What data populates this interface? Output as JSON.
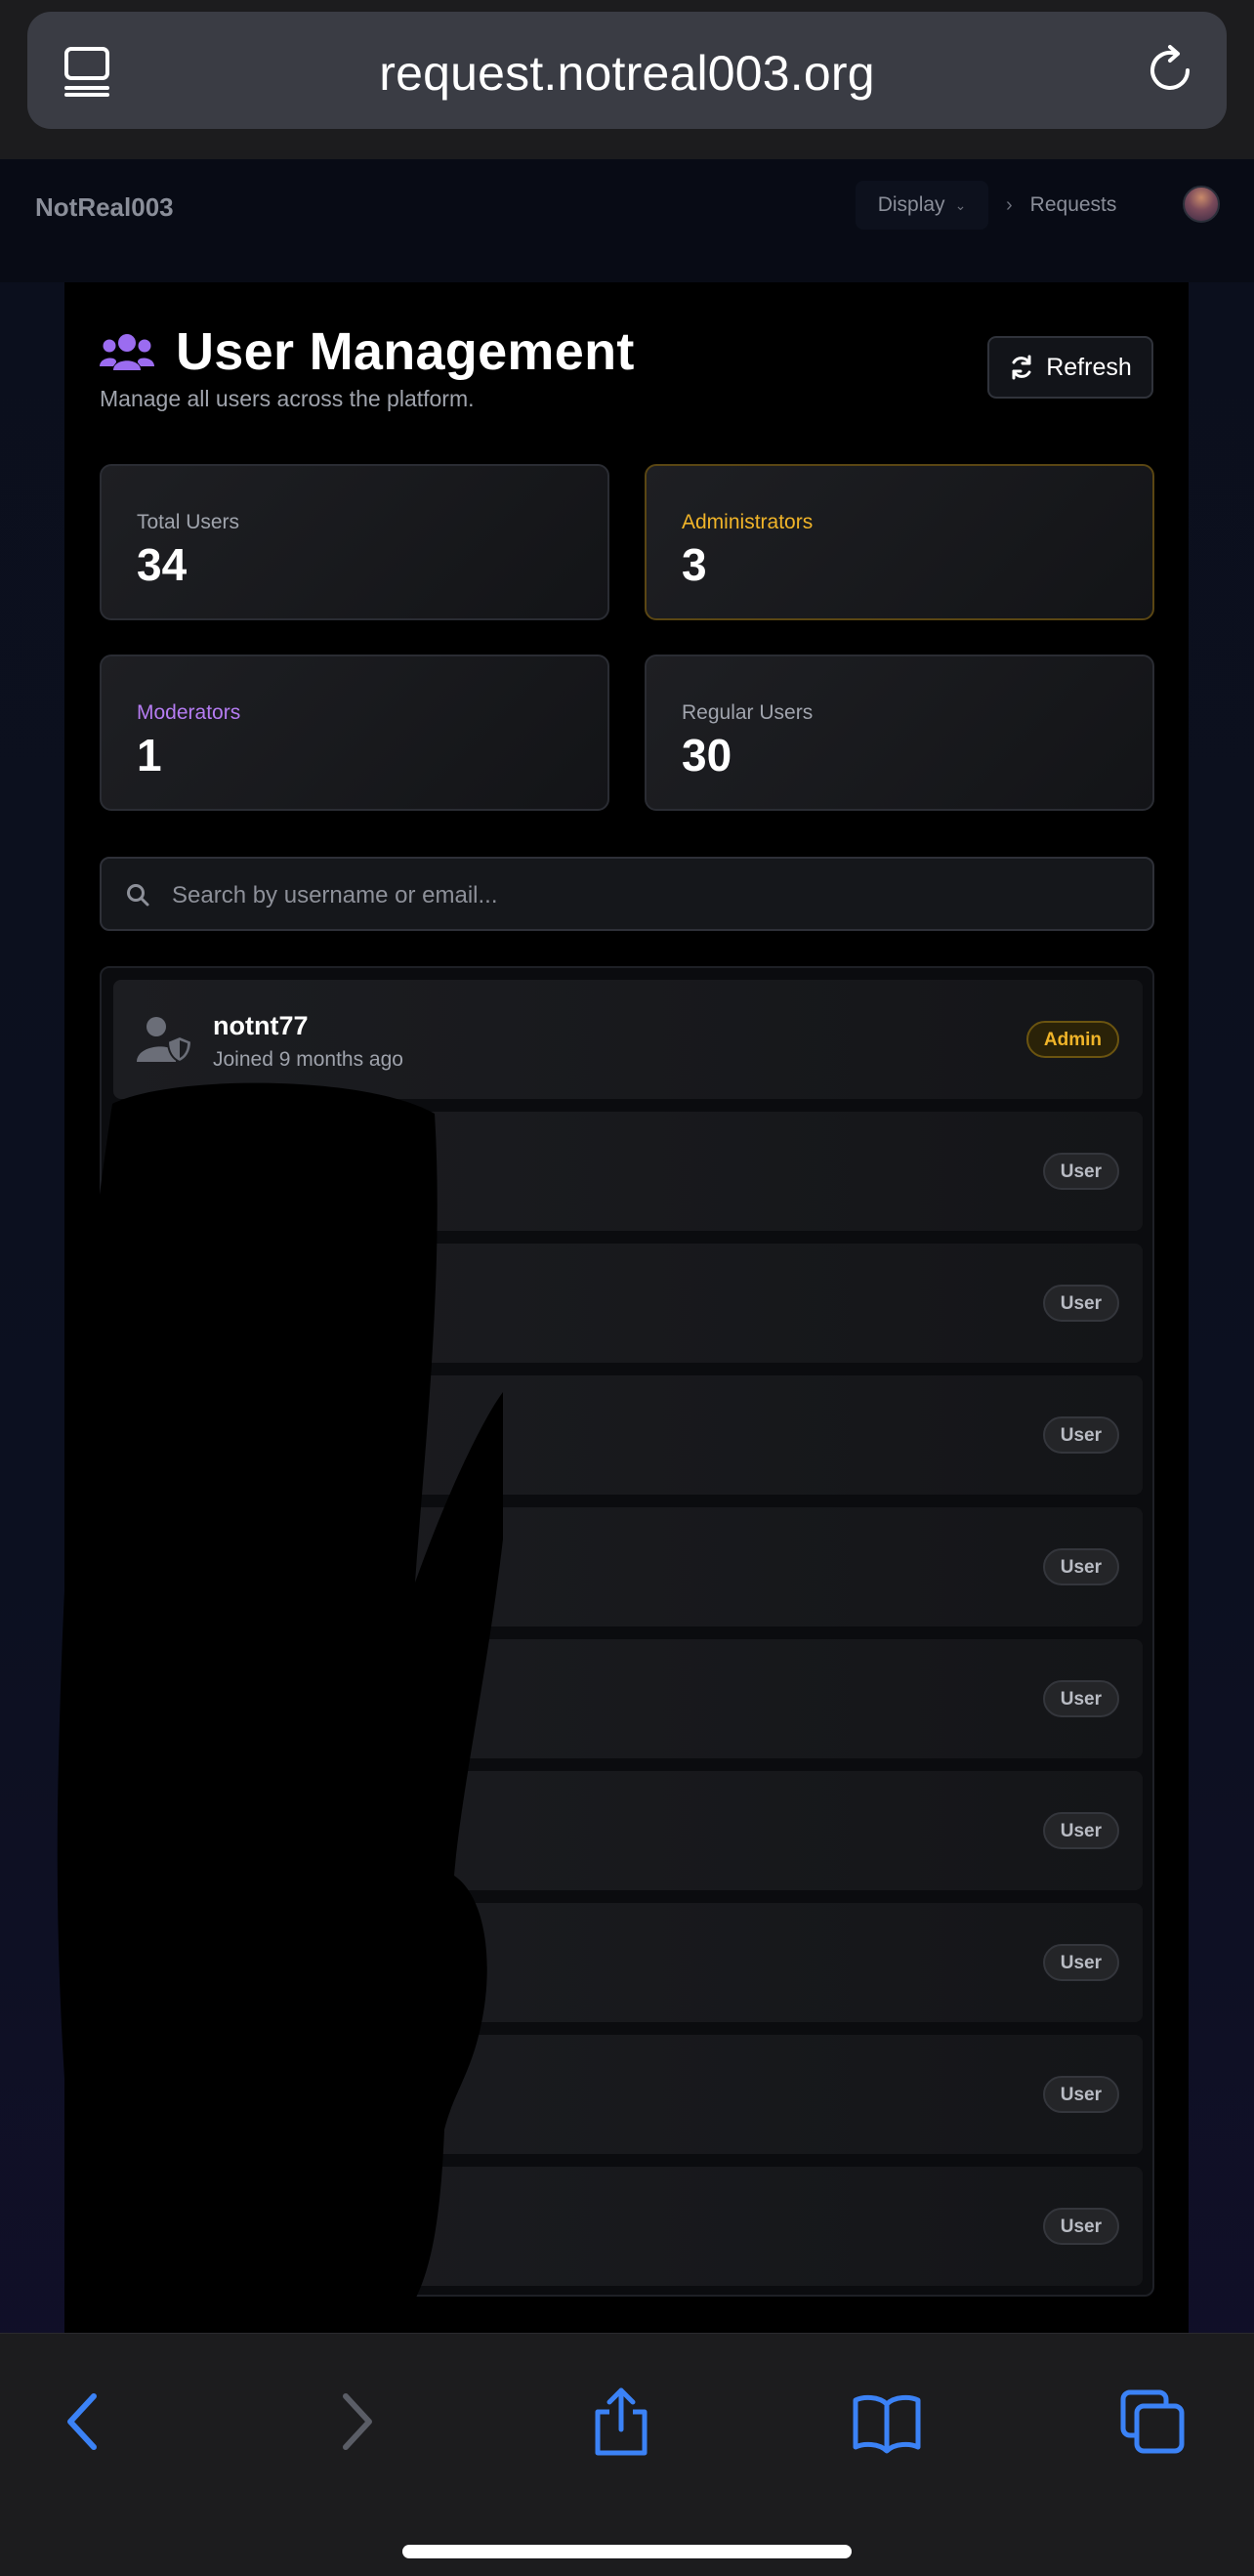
{
  "browser": {
    "url": "request.notreal003.org",
    "tabs_icon": "sidebar-icon",
    "reload_icon": "reload-icon"
  },
  "nav": {
    "brand": "NotReal003",
    "display_label": "Display",
    "requests_label": "Requests"
  },
  "page": {
    "title": "User Management",
    "subtitle": "Manage all users across the platform.",
    "refresh_label": "Refresh",
    "accent_color": "#9b6cf0"
  },
  "stats": {
    "total": {
      "label": "Total Users",
      "value": "34",
      "label_color": "#a0a4ad"
    },
    "admins": {
      "label": "Administrators",
      "value": "3",
      "label_color": "#f0b429"
    },
    "mods": {
      "label": "Moderators",
      "value": "1",
      "label_color": "#b57cf2"
    },
    "regular": {
      "label": "Regular Users",
      "value": "30",
      "label_color": "#a0a4ad"
    }
  },
  "search": {
    "placeholder": "Search by username or email..."
  },
  "users": [
    {
      "name": "notnt77",
      "joined": "Joined 9 months ago",
      "role": "Admin"
    },
    {
      "name": "",
      "joined": "",
      "role": "User"
    },
    {
      "name": "",
      "joined": "",
      "role": "User"
    },
    {
      "name": "",
      "joined": "",
      "role": "User"
    },
    {
      "name": "",
      "joined": "",
      "role": "User"
    },
    {
      "name": "",
      "joined": "",
      "role": "User"
    },
    {
      "name": "",
      "joined": "",
      "role": "User"
    },
    {
      "name": "",
      "joined": "",
      "role": "User"
    },
    {
      "name": "",
      "joined": "",
      "role": "User"
    },
    {
      "name": "",
      "joined": "",
      "role": "User"
    }
  ]
}
